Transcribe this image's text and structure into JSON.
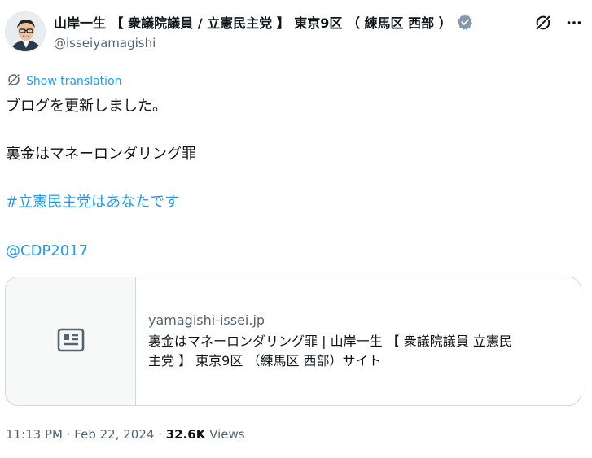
{
  "author": {
    "display_name": "山岸一生 【 衆議院議員 / 立憲民主党 】 東京9区 （ 練馬区 西部 ）",
    "handle": "@isseiyamagishi",
    "verified_color": "#829aab"
  },
  "translate": {
    "label": "Show translation"
  },
  "tweet": {
    "line1": "ブログを更新しました。",
    "line2": "裏金はマネーロンダリング罪",
    "hashtag": "#立憲民主党はあなたです",
    "mention": "@CDP2017"
  },
  "card": {
    "domain": "yamagishi-issei.jp",
    "title_line1": "裏金はマネーロンダリング罪 | 山岸一生 【 衆議院議員 立憲民",
    "title_line2": "主党 】 東京9区 （練馬区 西部）サイト",
    "icon": "article-icon"
  },
  "meta": {
    "time": "11:13 PM",
    "separator": " · ",
    "date": "Feb 22, 2024",
    "views_count": "32.6K",
    "views_label": " Views"
  },
  "colors": {
    "link": "#1d9bf0",
    "secondary": "#536471",
    "text": "#0f1419",
    "border": "#cfd9de"
  },
  "icons": {
    "grok": "grok-icon",
    "more": "more-icon",
    "translate": "translate-icon",
    "verified": "verified-badge-icon"
  }
}
